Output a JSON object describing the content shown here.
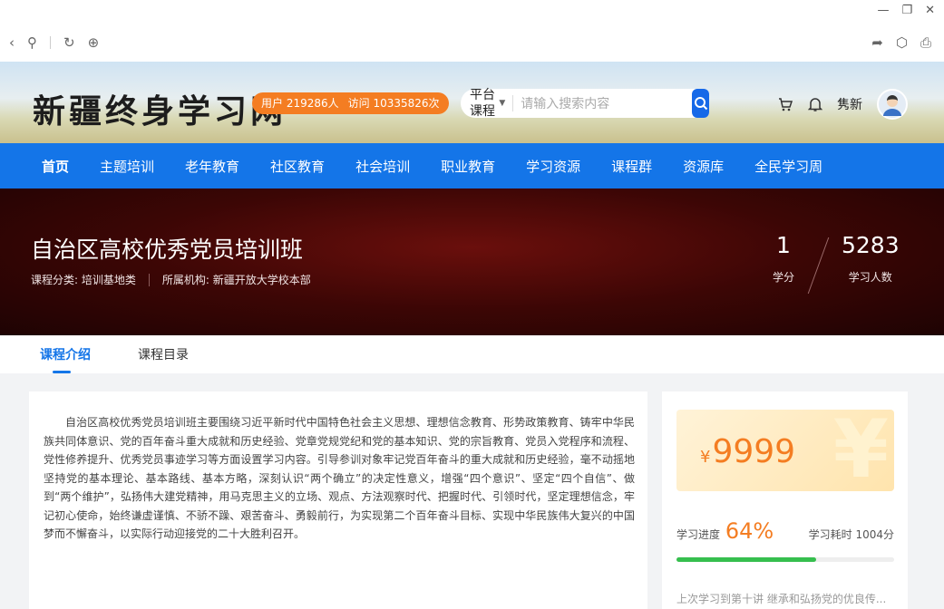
{
  "site": {
    "logo_text": "新疆终身学习网",
    "stats": {
      "users": "用户 219286人",
      "visits": "访问 10335826次"
    },
    "search": {
      "category": "平台课程",
      "placeholder": "请输入搜索内容"
    },
    "user_name": "隽新"
  },
  "nav": [
    {
      "label": "首页",
      "active": true
    },
    {
      "label": "主题培训"
    },
    {
      "label": "老年教育"
    },
    {
      "label": "社区教育"
    },
    {
      "label": "社会培训"
    },
    {
      "label": "职业教育"
    },
    {
      "label": "学习资源"
    },
    {
      "label": "课程群"
    },
    {
      "label": "资源库"
    },
    {
      "label": "全民学习周"
    }
  ],
  "course": {
    "title": "自治区高校优秀党员培训班",
    "category": "课程分类: 培训基地类",
    "org": "所属机构: 新疆开放大学校本部",
    "credit": {
      "value": "1",
      "label": "学分"
    },
    "learners": {
      "value": "5283",
      "label": "学习人数"
    }
  },
  "tabs": [
    {
      "label": "课程介绍",
      "active": true
    },
    {
      "label": "课程目录"
    }
  ],
  "intro_text": "自治区高校优秀党员培训班主要围绕习近平新时代中国特色社会主义思想、理想信念教育、形势政策教育、铸牢中华民族共同体意识、党的百年奋斗重大成就和历史经验、党章党规党纪和党的基本知识、党的宗旨教育、党员入党程序和流程、党性修养提升、优秀党员事迹学习等方面设置学习内容。引导参训对象牢记党百年奋斗的重大成就和历史经验，毫不动摇地坚持党的基本理论、基本路线、基本方略，深刻认识“两个确立”的决定性意义，增强“四个意识”、坚定“四个自信”、做到“两个维护”，弘扬伟大建党精神，用马克思主义的立场、观点、方法观察时代、把握时代、引领时代，坚定理想信念，牢记初心使命，始终谦虚谨慎、不骄不躁、艰苦奋斗、勇毅前行，为实现第二个百年奋斗目标、实现中华民族伟大复兴的中国梦而不懈奋斗，以实际行动迎接党的二十大胜利召开。",
  "side": {
    "currency": "¥",
    "price": "9999",
    "progress_label": "学习进度",
    "progress_pct": "64%",
    "progress_value": 0.64,
    "time_spent": "学习耗时 1004分",
    "last_study": "上次学习到第十讲 继承和弘扬党的优良传..."
  },
  "colors": {
    "primary": "#1475e8",
    "accent": "#f47d22",
    "progress": "#36bf4e"
  }
}
